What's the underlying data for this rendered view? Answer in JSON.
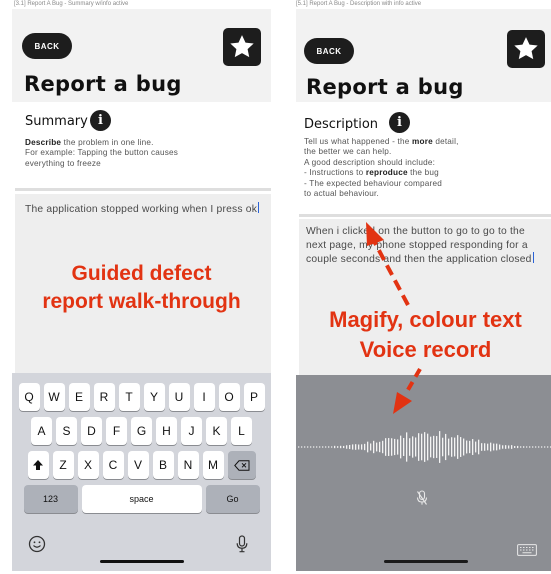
{
  "left_screen": {
    "caption": "[3.1] Report A Bug - Summary w/info active",
    "back_label": "BACK",
    "title": "Report a bug",
    "section_label": "Summary",
    "info_glyph": "i",
    "help": {
      "line1_bold": "Describe",
      "line1_rest": " the problem in one line.",
      "line2": "For example: Tapping the button causes",
      "line3": "everything to freeze"
    },
    "entered_text": "The application stopped working when I press ok",
    "annotation": {
      "line1": "Guided defect",
      "line2": "report walk-through"
    },
    "keyboard": {
      "row1": [
        "Q",
        "W",
        "E",
        "R",
        "T",
        "Y",
        "U",
        "I",
        "O",
        "P"
      ],
      "row2": [
        "A",
        "S",
        "D",
        "F",
        "G",
        "H",
        "J",
        "K",
        "L"
      ],
      "row3": [
        "Z",
        "X",
        "C",
        "V",
        "B",
        "N",
        "M"
      ],
      "numbers_key": "123",
      "space_key": "space",
      "go_key": "Go",
      "shift_icon": "shift-icon",
      "backspace_icon": "backspace-icon",
      "emoji_icon": "emoji-icon",
      "mic_icon": "microphone-icon"
    }
  },
  "right_screen": {
    "caption": "[5.1] Report A Bug - Description with info active",
    "back_label": "BACK",
    "title": "Report a bug",
    "section_label": "Description",
    "info_glyph": "i",
    "help": {
      "line1": "Tell us what happened - the ",
      "line1_bold": "more",
      "line1_end": " detail,",
      "line2": "the better we can help.",
      "line3": "A good description should include:",
      "line4_start": "- Instructions to ",
      "line4_bold": "reproduce",
      "line4_end": " the bug",
      "line5": "- The expected behaviour compared",
      "line6": "to actual behaviour."
    },
    "entered_text": "When i clicked on the button to go to go to the next page, my phone stopped responding for a couple seconds and then the application closed",
    "annotation": {
      "line1": "Magify, colour text",
      "line2": "Voice record"
    },
    "voice": {
      "mic_muted_icon": "microphone-muted-icon",
      "keyboard_icon": "keyboard-icon"
    }
  },
  "colors": {
    "annotation_red": "#e23312",
    "header_gray": "#f2f2f2",
    "button_dark": "#1d1d1d",
    "keyboard_gray": "#d3d5db",
    "voice_panel_gray": "#8c8e93",
    "caret_blue": "#2a62d6"
  },
  "icons": {
    "favorite": "star-icon",
    "info": "info-icon",
    "arrow": "red-dashed-arrow"
  }
}
